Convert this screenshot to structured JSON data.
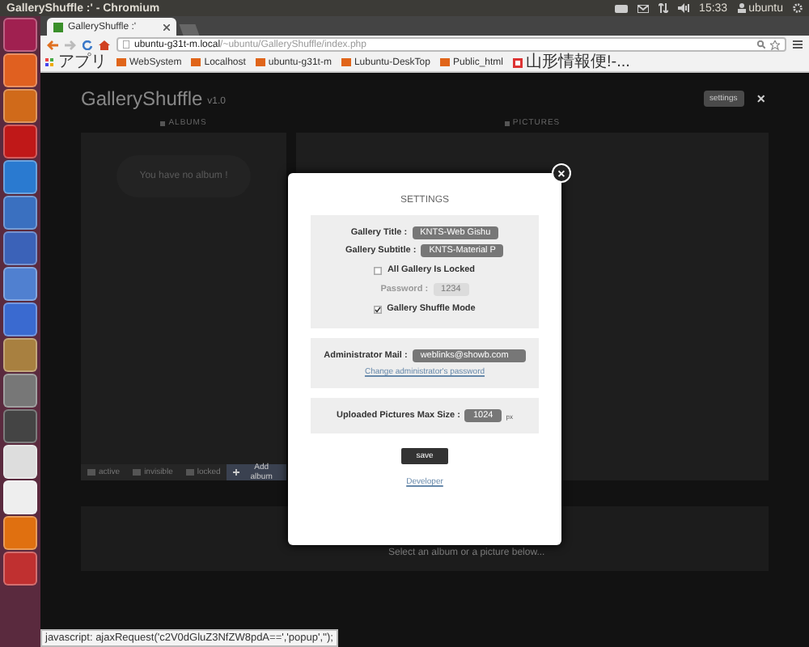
{
  "top_panel": {
    "title": "GalleryShuffle :' - Chromium",
    "clock": "15:33",
    "user": "ubuntu"
  },
  "browser": {
    "tab": {
      "title": "GalleryShuffle :'",
      "selected": true
    },
    "url_host": "ubuntu-g31t-m.local",
    "url_path": "/~ubuntu/GalleryShuffle/index.php",
    "bookmarks": [
      {
        "label": "アプリ",
        "kind": "apps"
      },
      {
        "label": "WebSystem",
        "kind": "folder"
      },
      {
        "label": "Localhost",
        "kind": "folder"
      },
      {
        "label": "ubuntu-g31t-m",
        "kind": "folder"
      },
      {
        "label": "Lubuntu-DeskTop",
        "kind": "folder"
      },
      {
        "label": "Public_html",
        "kind": "folder"
      },
      {
        "label": "山形情報便!-...",
        "kind": "page"
      }
    ],
    "status_text": "javascript: ajaxRequest('c2V0dGluZ3NfZW8pdA==','popup','');"
  },
  "page": {
    "title": "GalleryShuffle",
    "version": "v1.0",
    "settings_button": "settings",
    "close": "×",
    "albums": {
      "heading": "ALBUMS",
      "empty": "You have no album !",
      "filters": [
        "active",
        "invisible",
        "locked"
      ],
      "add": "Add album"
    },
    "pictures": {
      "heading": "PICTURES"
    },
    "preview": {
      "hint": "Select an album or a picture below..."
    }
  },
  "dialog": {
    "close": "×",
    "title": "SETTINGS",
    "fields": [
      {
        "label": "Gallery Title :",
        "value": "KNTS-Web Gishu",
        "kind": "text"
      },
      {
        "label": "Gallery Subtitle :",
        "value": "KNTS-Material P",
        "kind": "text"
      },
      {
        "label": "All Gallery Is Locked",
        "checked": false,
        "kind": "check"
      },
      {
        "label": "Password :",
        "value": "1234",
        "disabled": true,
        "kind": "text"
      },
      {
        "label": "Gallery Shuffle Mode",
        "checked": true,
        "kind": "check"
      }
    ],
    "admin": {
      "label": "Administrator Mail :",
      "value": "weblinks@showb.com",
      "link": "Change administrator's password"
    },
    "size": {
      "label": "Uploaded Pictures Max Size :",
      "value": "1024",
      "unit": "px"
    },
    "save": "save",
    "developer": "Developer"
  }
}
